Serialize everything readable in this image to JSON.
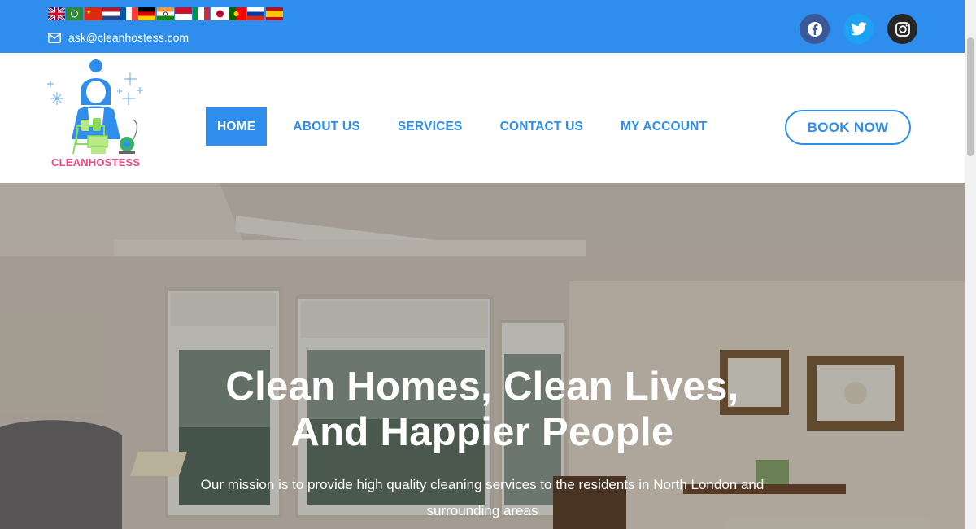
{
  "topbar": {
    "flags": [
      {
        "name": "english-flag-icon",
        "lang": "English"
      },
      {
        "name": "arabic-flag-icon",
        "lang": "Arabic"
      },
      {
        "name": "chinese-flag-icon",
        "lang": "Chinese"
      },
      {
        "name": "dutch-flag-icon",
        "lang": "Dutch"
      },
      {
        "name": "french-flag-icon",
        "lang": "French"
      },
      {
        "name": "german-flag-icon",
        "lang": "German"
      },
      {
        "name": "hindi-flag-icon",
        "lang": "Hindi"
      },
      {
        "name": "indonesian-flag-icon",
        "lang": "Indonesian"
      },
      {
        "name": "italian-flag-icon",
        "lang": "Italian"
      },
      {
        "name": "japanese-flag-icon",
        "lang": "Japanese"
      },
      {
        "name": "portuguese-flag-icon",
        "lang": "Portuguese"
      },
      {
        "name": "russian-flag-icon",
        "lang": "Russian"
      },
      {
        "name": "spanish-flag-icon",
        "lang": "Spanish"
      }
    ],
    "email": "ask@cleanhostess.com",
    "socials": [
      "facebook-icon",
      "twitter-icon",
      "instagram-icon"
    ]
  },
  "header": {
    "logo_text": "CLEANHOSTESS",
    "nav": [
      "HOME",
      "ABOUT US",
      "SERVICES",
      "CONTACT US",
      "MY ACCOUNT"
    ],
    "active_nav": "HOME",
    "book_button": "BOOK NOW"
  },
  "hero": {
    "title_line1": "Clean Homes, Clean Lives,",
    "title_line2": "And Happier People",
    "subtitle": "Our mission is to provide high quality cleaning services to the residents in North London and surrounding areas"
  },
  "colors": {
    "accent": "#2f8eed",
    "logo_pink": "#e24e84",
    "facebook": "#3b5998",
    "twitter": "#1da1f2",
    "instagram": "#262626"
  }
}
